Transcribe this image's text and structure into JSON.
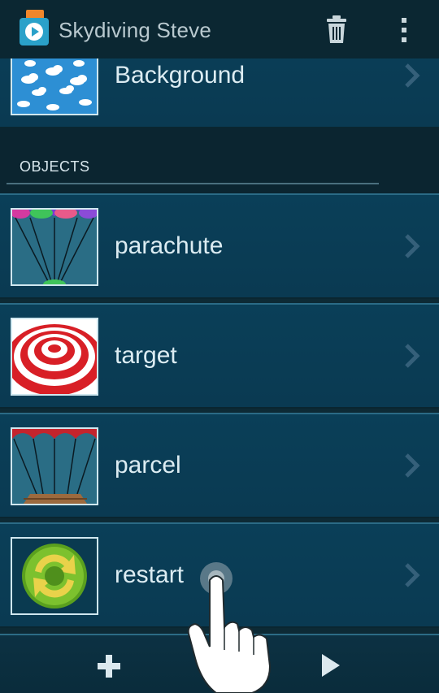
{
  "actionbar": {
    "title": "Skydiving Steve"
  },
  "rows": [
    {
      "label": "Background",
      "thumbnail": "sky-clouds"
    }
  ],
  "section": {
    "title": "OBJECTS"
  },
  "objects": [
    {
      "label": "parachute",
      "thumbnail": "parachute"
    },
    {
      "label": "target",
      "thumbnail": "target"
    },
    {
      "label": "parcel",
      "thumbnail": "parcel"
    },
    {
      "label": "restart",
      "thumbnail": "restart-arrows"
    }
  ],
  "bottombar": {
    "add_icon": "plus-icon",
    "play_icon": "play-icon"
  },
  "colors": {
    "background": "#0d2a35",
    "row": "#0a3f58",
    "accent_line": "#2b6b86"
  }
}
